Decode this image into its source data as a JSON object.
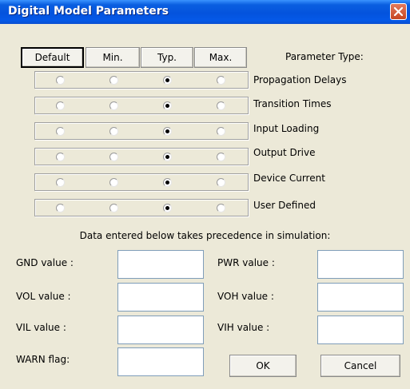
{
  "window": {
    "title": "Digital Model Parameters"
  },
  "headers": {
    "default": "Default",
    "min": "Min.",
    "typ": "Typ.",
    "max": "Max.",
    "parameter_type": "Parameter Type:"
  },
  "parameters": [
    {
      "label": "Propagation Delays",
      "selected": "Typ."
    },
    {
      "label": "Transition Times",
      "selected": "Typ."
    },
    {
      "label": "Input Loading",
      "selected": "Typ."
    },
    {
      "label": "Output Drive",
      "selected": "Typ."
    },
    {
      "label": "Device Current",
      "selected": "Typ."
    },
    {
      "label": "User Defined",
      "selected": "Typ."
    }
  ],
  "note": "Data entered below takes precedence in simulation:",
  "fields": {
    "gnd": {
      "label": "GND value :",
      "value": ""
    },
    "pwr": {
      "label": "PWR value :",
      "value": ""
    },
    "vol": {
      "label": "VOL value :",
      "value": ""
    },
    "voh": {
      "label": "VOH value :",
      "value": ""
    },
    "vil": {
      "label": "VIL value :",
      "value": ""
    },
    "vih": {
      "label": "VIH value :",
      "value": ""
    },
    "warn": {
      "label": "WARN flag:",
      "value": ""
    }
  },
  "buttons": {
    "ok": "OK",
    "cancel": "Cancel"
  },
  "icons": {
    "close": "close-icon"
  }
}
